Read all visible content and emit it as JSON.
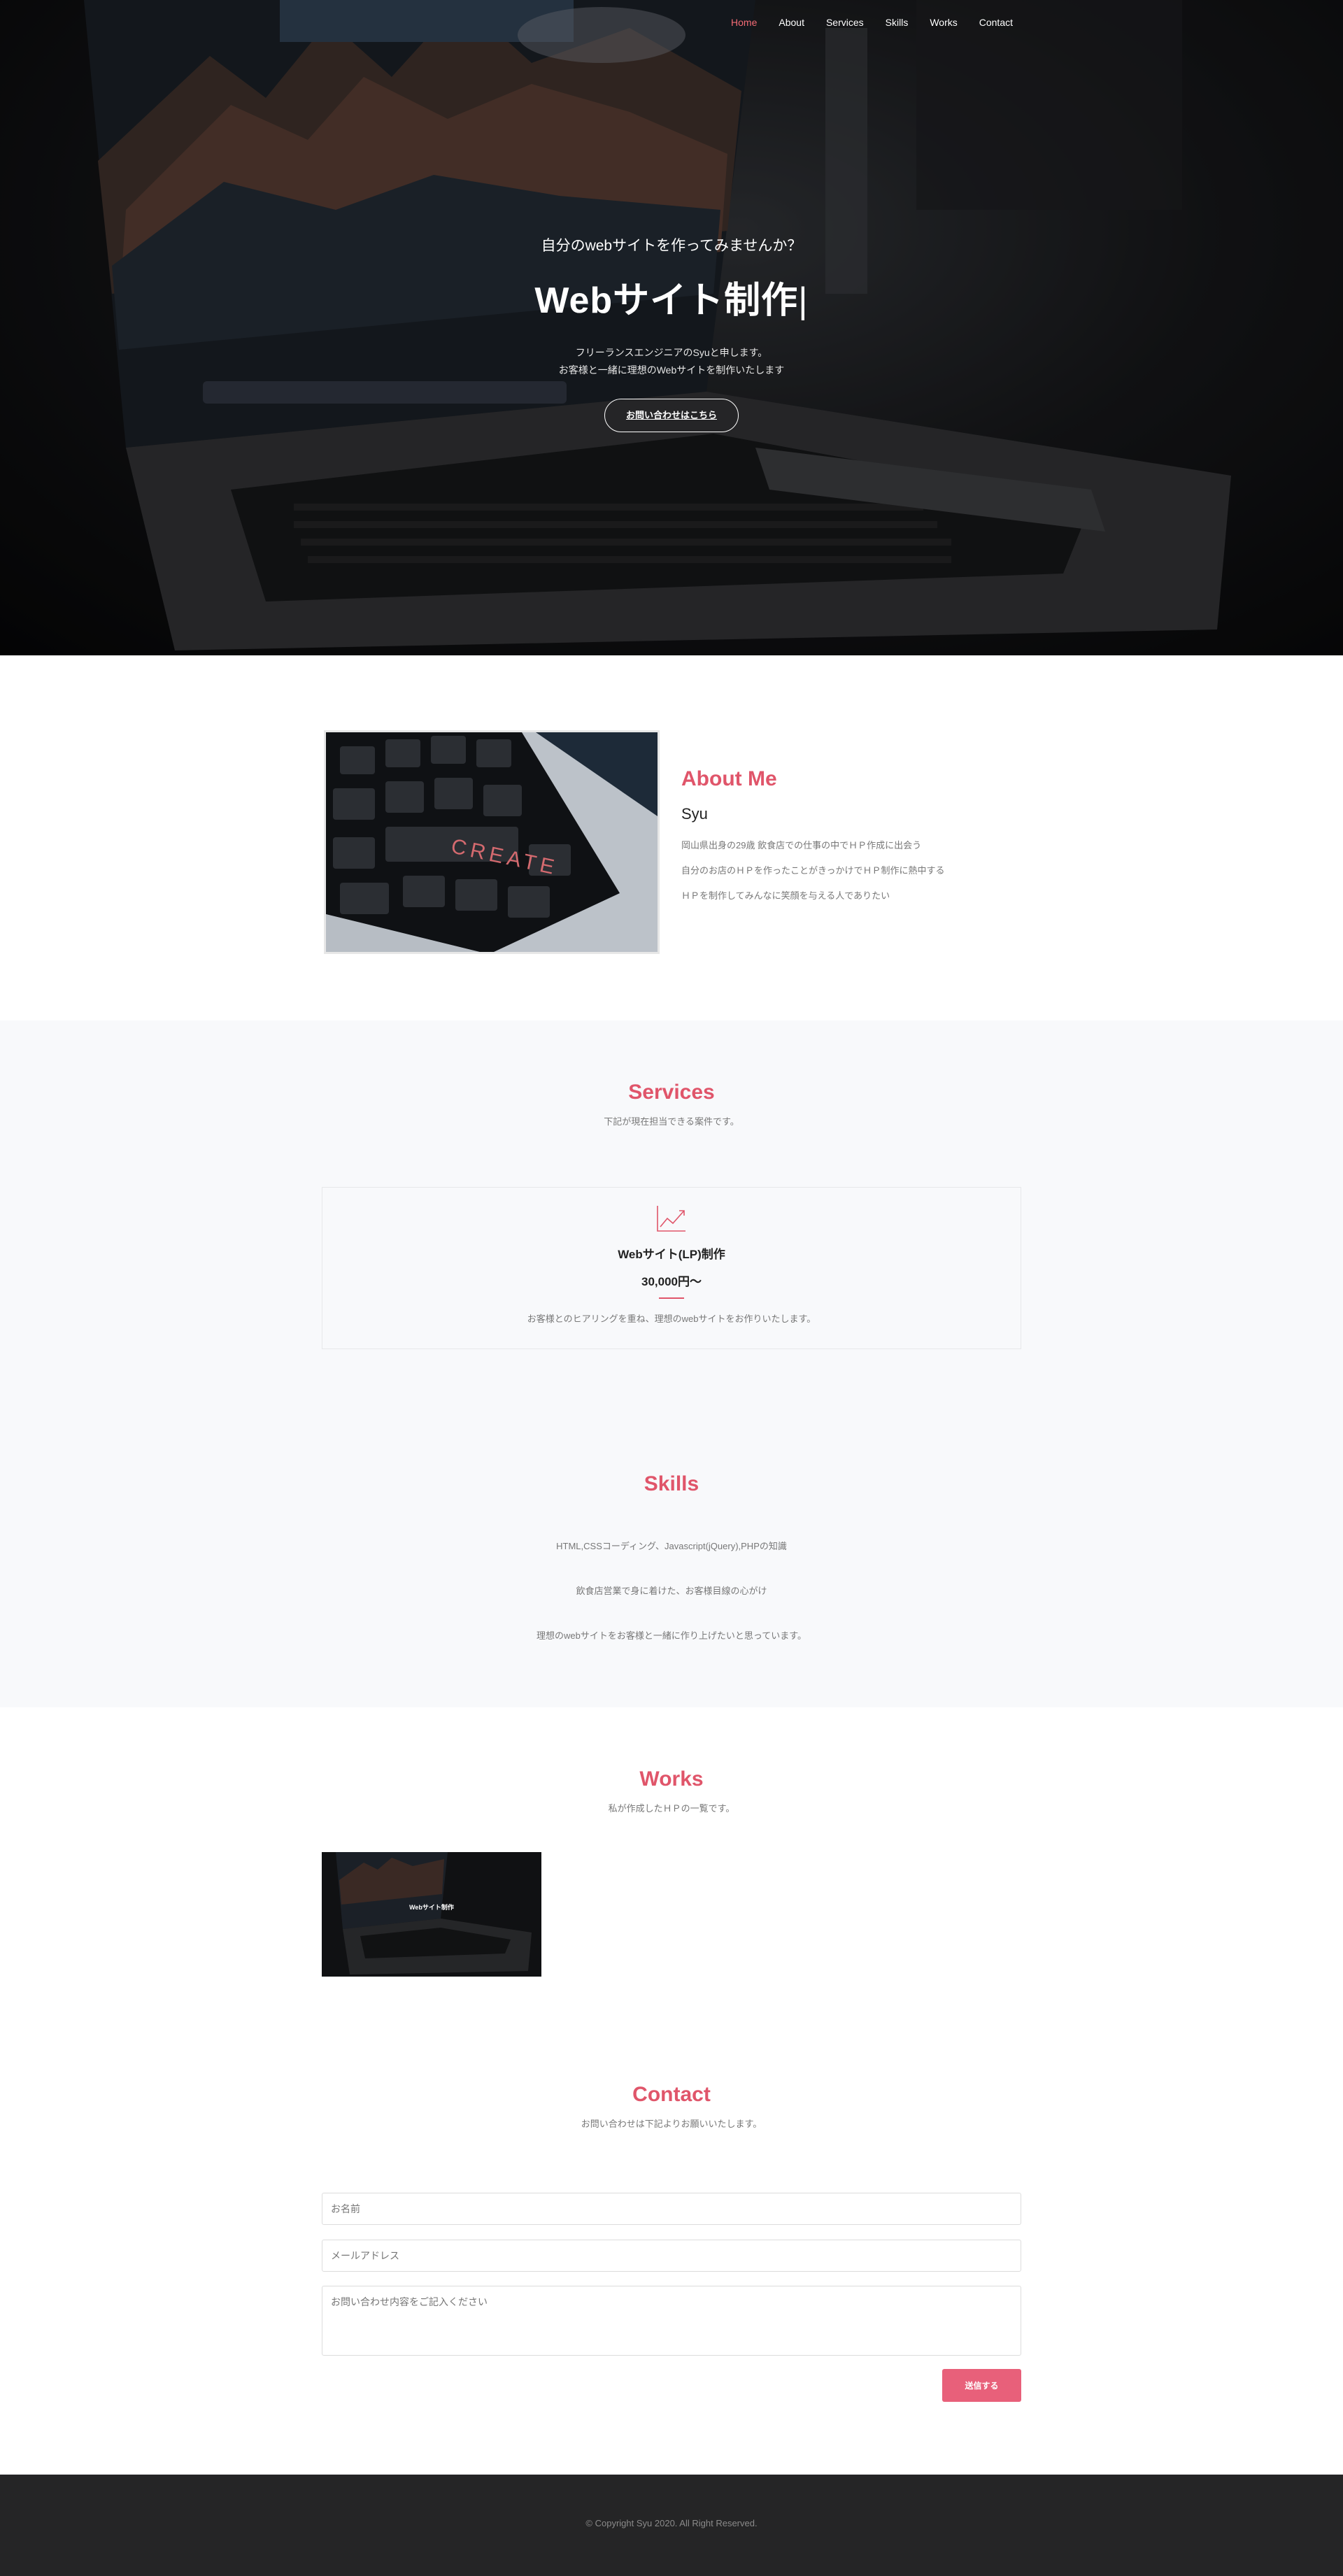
{
  "nav": {
    "items": [
      {
        "label": "Home",
        "active": true
      },
      {
        "label": "About",
        "active": false
      },
      {
        "label": "Services",
        "active": false
      },
      {
        "label": "Skills",
        "active": false
      },
      {
        "label": "Works",
        "active": false
      },
      {
        "label": "Contact",
        "active": false
      }
    ]
  },
  "hero": {
    "lead": "自分のwebサイトを作ってみませんか？",
    "title": "Webサイト制作",
    "cursor": "|",
    "desc_line1": "フリーランスエンジニアのSyuと申します。",
    "desc_line2": "お客様と一緒に理想のWebサイトを制作いたします",
    "button": "お問い合わせはこちら"
  },
  "about": {
    "title": "About Me",
    "name": "Syu",
    "lines": [
      "岡山県出身の29歳 飲食店での仕事の中でＨＰ作成に出会う",
      "自分のお店のＨＰを作ったことがきっかけでＨＰ制作に熱中する",
      "ＨＰを制作してみんなに笑顔を与える人でありたい"
    ],
    "image_icon": "keyboard-create-photo"
  },
  "services": {
    "title": "Services",
    "subtitle": "下記が現在担当できる案件です。",
    "card": {
      "icon": "line-chart-icon",
      "name": "Webサイト(LP)制作",
      "price": "30,000円〜",
      "desc": "お客様とのヒアリングを重ね、理想のwebサイトをお作りいたします。"
    }
  },
  "skills": {
    "title": "Skills",
    "items": [
      "HTML,CSSコーディング、Javascript(jQuery),PHPの知識",
      "飲食店営業で身に着けた、お客様目線の心がけ",
      "理想のwebサイトをお客様と一緒に作り上げたいと思っています。"
    ]
  },
  "works": {
    "title": "Works",
    "subtitle": "私が作成したＨＰの一覧です。",
    "thumb_caption": "Webサイト制作"
  },
  "contact": {
    "title": "Contact",
    "subtitle": "お問い合わせは下記よりお願いいたします。",
    "name_placeholder": "お名前",
    "email_placeholder": "メールアドレス",
    "message_placeholder": "お問い合わせ内容をご記入ください",
    "send": "送信する"
  },
  "footer": {
    "copyright": "© Copyright Syu 2020. All Right Reserved."
  },
  "colors": {
    "accent": "#e0556a",
    "button": "#e8607a",
    "footer_bg": "#252526",
    "section_gray": "#f8f9fb"
  }
}
